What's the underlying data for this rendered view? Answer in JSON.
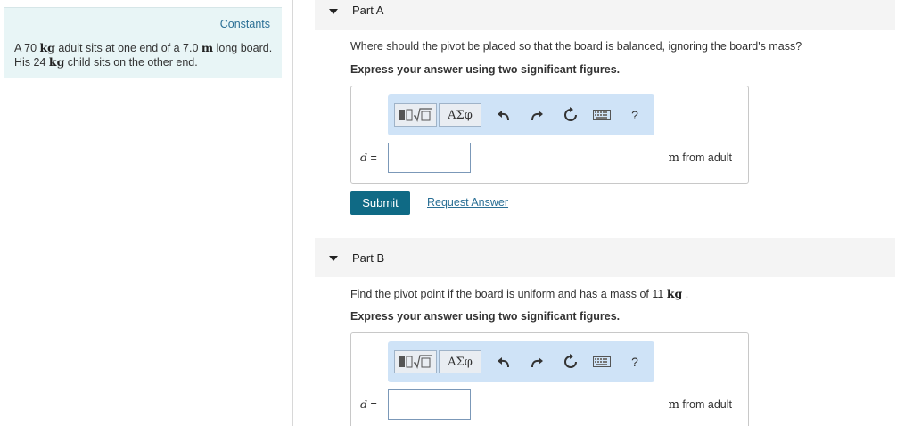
{
  "sidebar": {
    "constants_link": "Constants",
    "problem": {
      "t1": "A 70 ",
      "u1": "kg",
      "t2": " adult sits at one end of a 7.0 ",
      "u2": "m",
      "t3": " long board. His 24 ",
      "u3": "kg",
      "t4": " child sits on the other end."
    }
  },
  "toolbar_labels": {
    "greek": "ΑΣφ",
    "help": "?"
  },
  "icons": {
    "templates": "templates-icon",
    "greek": "greek-symbols-icon",
    "undo": "undo-icon",
    "redo": "redo-icon",
    "reset": "reset-icon",
    "keyboard": "keyboard-icon",
    "help": "help-icon"
  },
  "part_a": {
    "title": "Part A",
    "question": "Where should the pivot be placed so that the board is balanced, ignoring the board's mass?",
    "instruction": "Express your answer using two significant figures.",
    "var": "d",
    "eq": " =",
    "input_value": "",
    "unit_m": "m",
    "unit_rest": " from adult",
    "submit": "Submit",
    "request": "Request Answer"
  },
  "part_b": {
    "title": "Part B",
    "q1": "Find the pivot point if the board is uniform and has a mass of 11 ",
    "q_unit": "kg",
    "q2": " .",
    "instruction": "Express your answer using two significant figures.",
    "var": "d",
    "eq": " =",
    "input_value": "",
    "unit_m": "m",
    "unit_rest": " from adult"
  }
}
